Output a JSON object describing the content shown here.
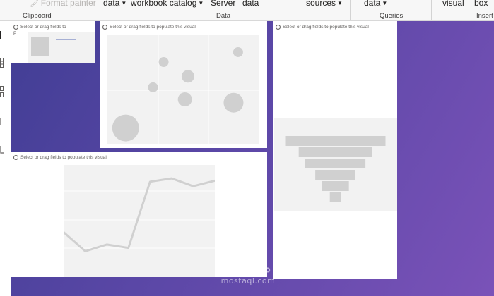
{
  "ribbon": {
    "clipboard": {
      "format_painter": "Format painter",
      "label": "Clipboard"
    },
    "data": {
      "get_data": "data",
      "workbook_catalog": "workbook catalog",
      "server": "Server",
      "data_item": "data",
      "label": "Data"
    },
    "queries": {
      "sources": "sources",
      "transform_data": "data",
      "label": "Queries"
    },
    "insert": {
      "visual": "visual",
      "text_box": "box",
      "label": "Insert"
    }
  },
  "visuals": {
    "hint": "Select or drag fields to populate this visual",
    "small_hint": "Select or drag fields to"
  },
  "scatter_chart": {
    "chart_data": {
      "type": "scatter",
      "points": [
        {
          "x": 0.12,
          "y": 0.15,
          "size": 19
        },
        {
          "x": 0.37,
          "y": 0.75,
          "size": 7
        },
        {
          "x": 0.3,
          "y": 0.52,
          "size": 7
        },
        {
          "x": 0.53,
          "y": 0.62,
          "size": 9
        },
        {
          "x": 0.51,
          "y": 0.41,
          "size": 10
        },
        {
          "x": 0.83,
          "y": 0.38,
          "size": 14
        },
        {
          "x": 0.86,
          "y": 0.84,
          "size": 7
        }
      ],
      "xlim": [
        0,
        1
      ],
      "ylim": [
        0,
        1
      ],
      "grid": true
    }
  },
  "line_chart": {
    "chart_data": {
      "type": "line",
      "values": [
        0.4,
        0.23,
        0.29,
        0.26,
        0.85,
        0.88,
        0.81,
        0.86
      ],
      "ylim": [
        0,
        1
      ],
      "grid": true
    }
  },
  "funnel_chart": {
    "chart_data": {
      "type": "funnel",
      "values": [
        1.0,
        0.73,
        0.6,
        0.4,
        0.27,
        0.11
      ]
    }
  },
  "colors": {
    "placeholder_mark": "#d0d0d0",
    "placeholder_bg": "#f2f2f2",
    "canvas_start": "#3f3d93",
    "canvas_end": "#7a52b8"
  },
  "watermark": {
    "arabic": "مستقل",
    "latin": "mostaql.com"
  }
}
